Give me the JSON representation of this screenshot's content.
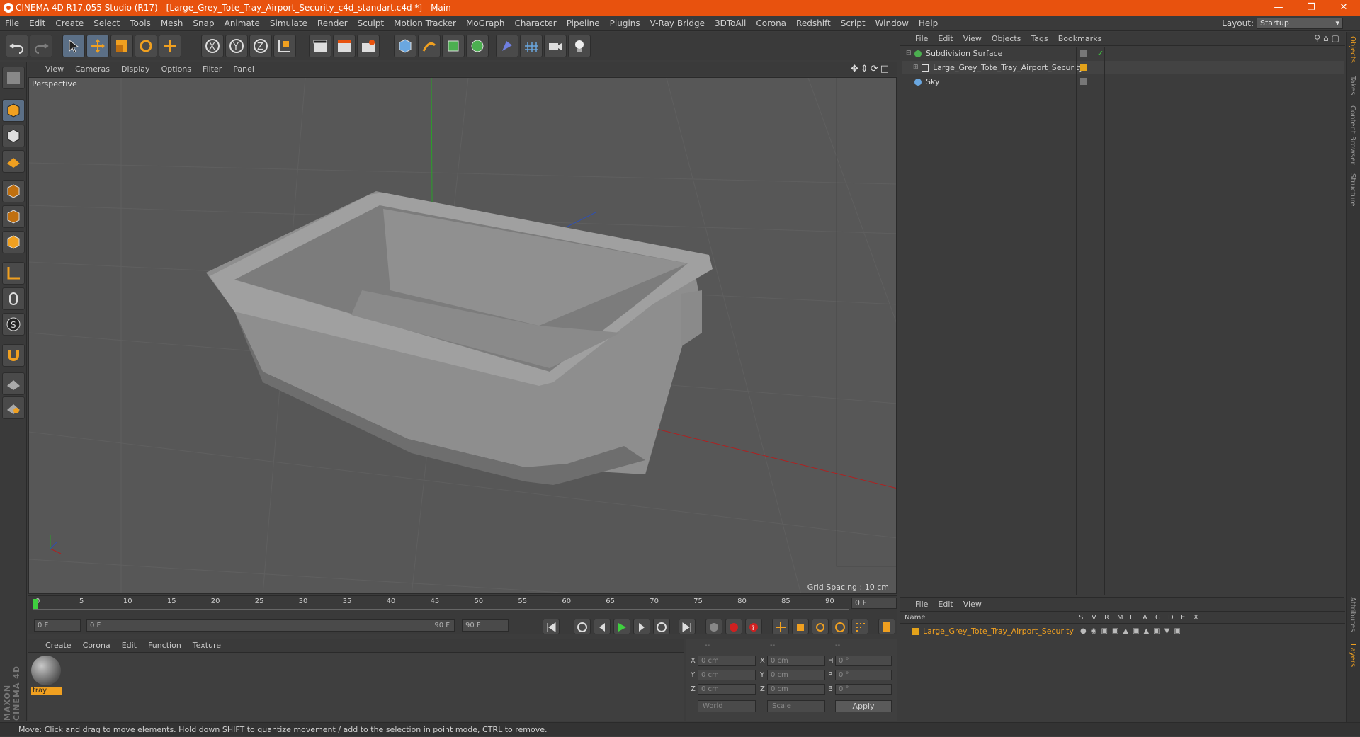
{
  "window": {
    "title": "CINEMA 4D R17.055 Studio (R17) - [Large_Grey_Tote_Tray_Airport_Security_c4d_standart.c4d *] - Main"
  },
  "menubar": {
    "items": [
      "File",
      "Edit",
      "Create",
      "Select",
      "Tools",
      "Mesh",
      "Snap",
      "Animate",
      "Simulate",
      "Render",
      "Sculpt",
      "Motion Tracker",
      "MoGraph",
      "Character",
      "Pipeline",
      "Plugins",
      "V-Ray Bridge",
      "3DToAll",
      "Corona",
      "Redshift",
      "Script",
      "Window",
      "Help"
    ],
    "layout_label": "Layout:",
    "layout_value": "Startup"
  },
  "viewport": {
    "menu": [
      "View",
      "Cameras",
      "Display",
      "Options",
      "Filter",
      "Panel"
    ],
    "label": "Perspective",
    "grid_spacing": "Grid Spacing : 10 cm"
  },
  "timeline": {
    "ticks": [
      "0",
      "5",
      "10",
      "15",
      "20",
      "25",
      "30",
      "35",
      "40",
      "45",
      "50",
      "55",
      "60",
      "65",
      "70",
      "75",
      "80",
      "85",
      "90"
    ],
    "current_frame": "0 F",
    "start_field": "0 F",
    "range_start": "0 F",
    "range_end": "90 F",
    "end_field": "90 F"
  },
  "material_manager": {
    "menu": [
      "Create",
      "Corona",
      "Edit",
      "Function",
      "Texture"
    ],
    "materials": [
      {
        "name": "tray"
      }
    ]
  },
  "coordinates": {
    "headers": [
      "--",
      "--",
      "--"
    ],
    "rows": [
      {
        "a_label": "X",
        "a_val": "0 cm",
        "b_label": "X",
        "b_val": "0 cm",
        "c_label": "H",
        "c_val": "0 °"
      },
      {
        "a_label": "Y",
        "a_val": "0 cm",
        "b_label": "Y",
        "b_val": "0 cm",
        "c_label": "P",
        "c_val": "0 °"
      },
      {
        "a_label": "Z",
        "a_val": "0 cm",
        "b_label": "Z",
        "b_val": "0 cm",
        "c_label": "B",
        "c_val": "0 °"
      }
    ],
    "mode1": "World",
    "mode2": "Scale",
    "apply": "Apply"
  },
  "object_manager": {
    "menu": [
      "File",
      "Edit",
      "View",
      "Objects",
      "Tags",
      "Bookmarks"
    ],
    "objects": [
      {
        "name": "Subdivision Surface"
      },
      {
        "name": "Large_Grey_Tote_Tray_Airport_Security"
      },
      {
        "name": "Sky"
      }
    ]
  },
  "layer_manager": {
    "menu": [
      "File",
      "Edit",
      "View"
    ],
    "header_name": "Name",
    "header_cols": [
      "S",
      "V",
      "R",
      "M",
      "L",
      "A",
      "G",
      "D",
      "E",
      "X"
    ],
    "layers": [
      {
        "name": "Large_Grey_Tote_Tray_Airport_Security",
        "color": "#e3a21a"
      }
    ]
  },
  "side_tabs": [
    "Objects",
    "Takes",
    "Content Browser",
    "Structure"
  ],
  "side_tabs_bottom": [
    "Attributes",
    "Layers"
  ],
  "status": "Move: Click and drag to move elements. Hold down SHIFT to quantize movement / add to the selection in point mode, CTRL to remove.",
  "colors": {
    "title_bar": "#e8520e",
    "accent_orange": "#f0a020",
    "selected_tool": "#5b6f86"
  }
}
